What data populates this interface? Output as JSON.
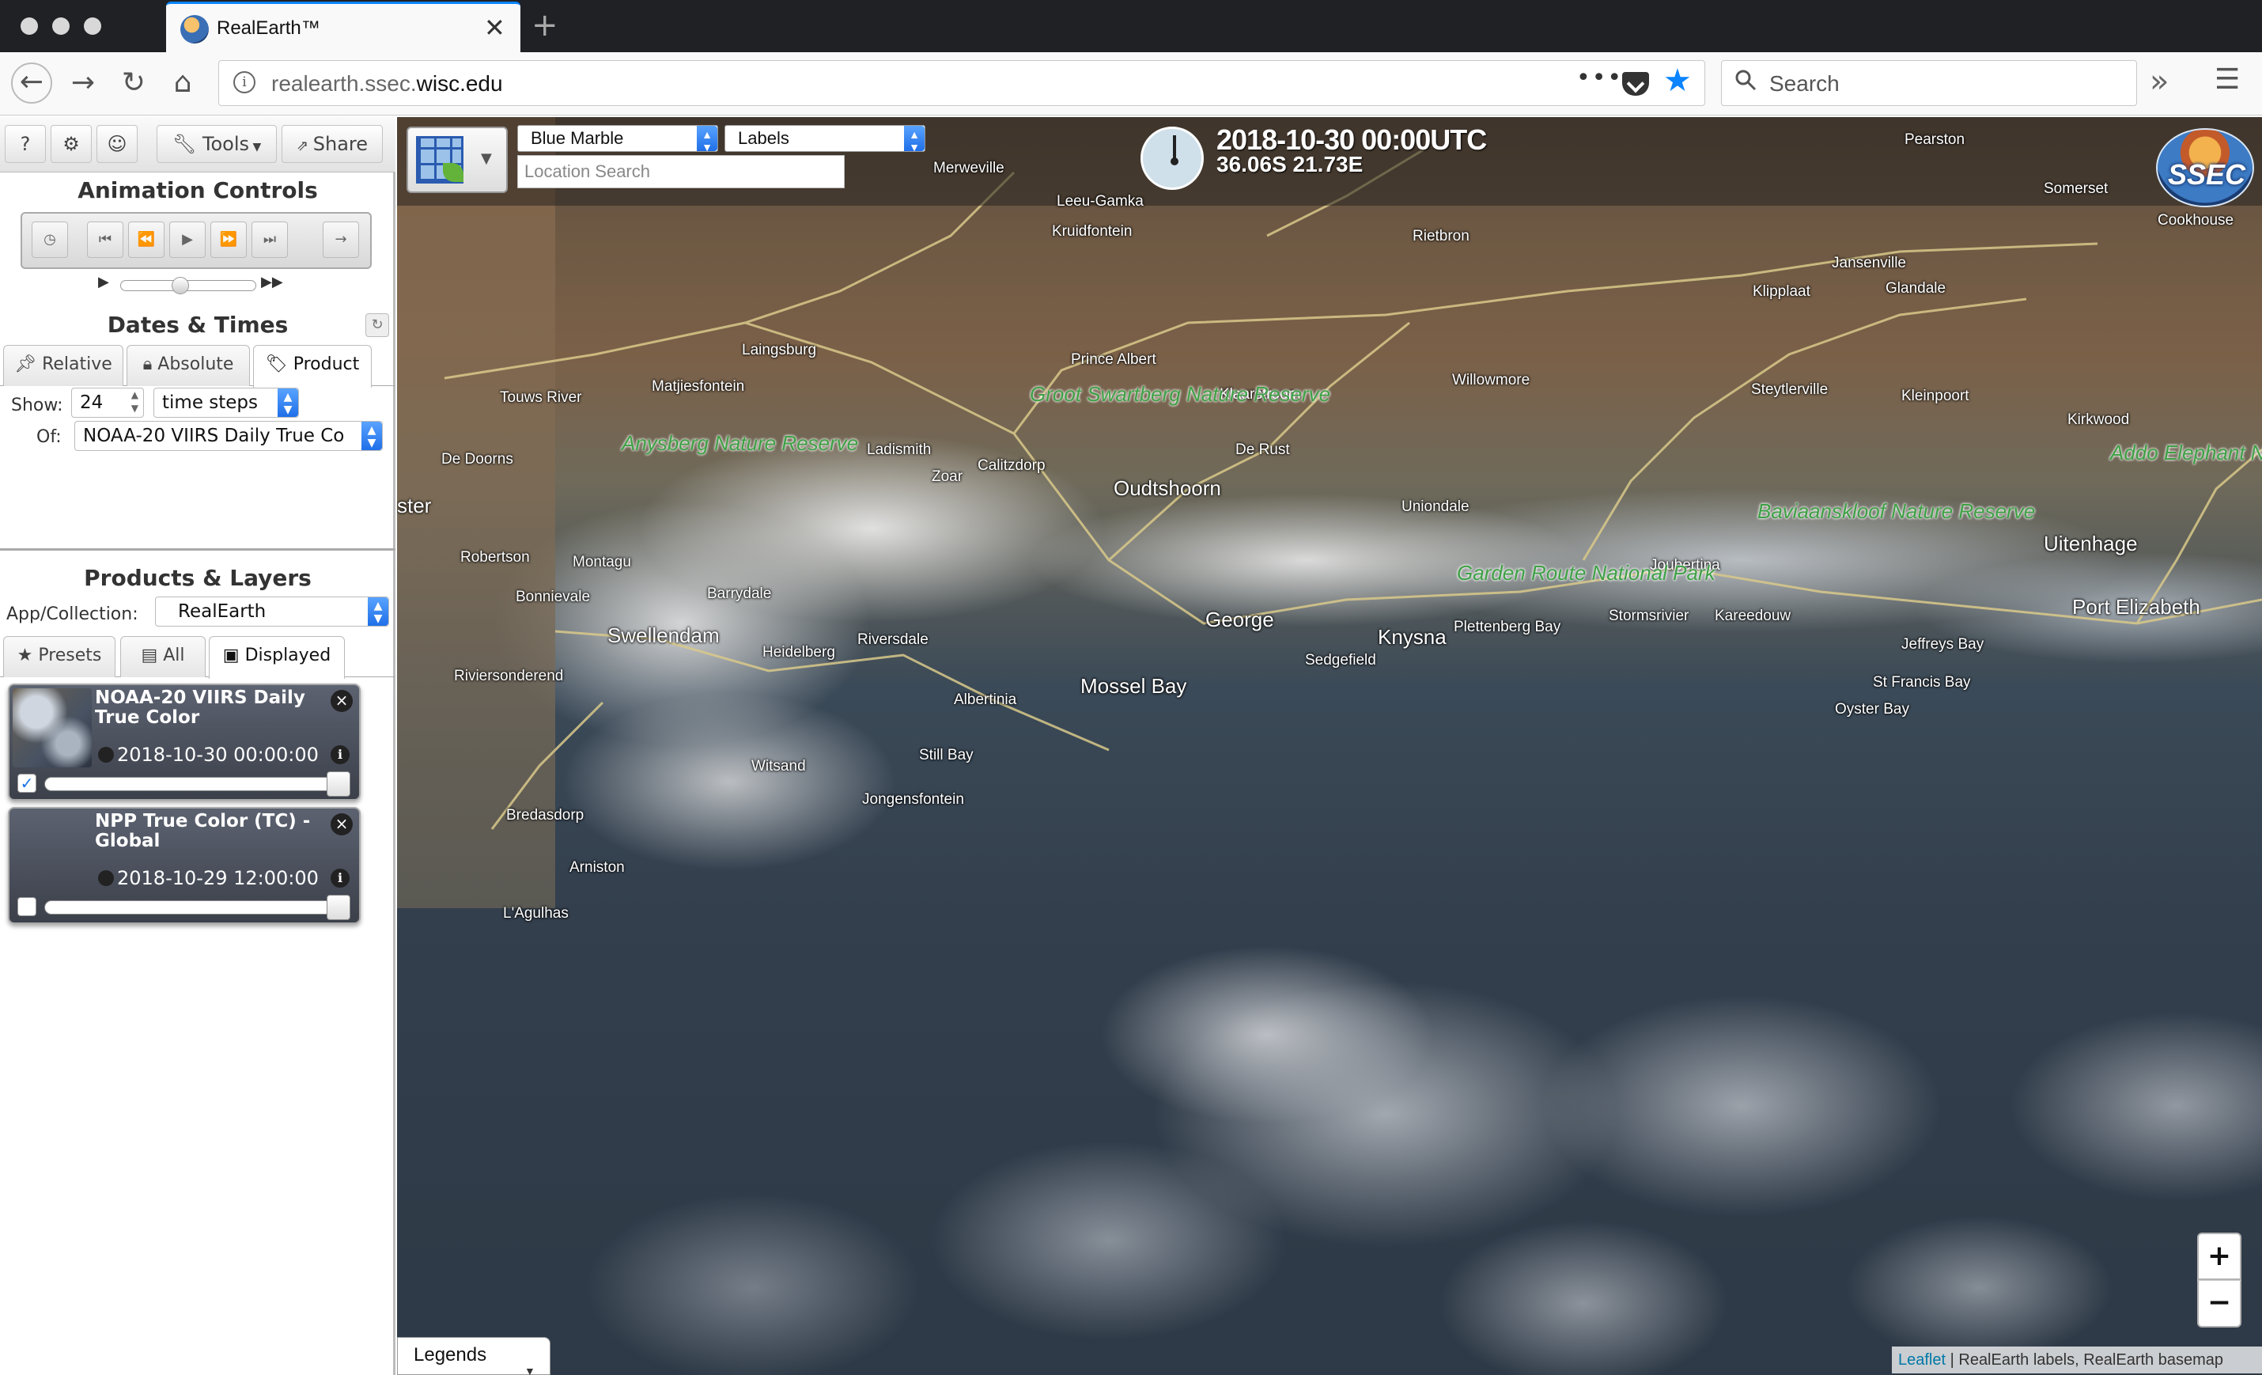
{
  "browser": {
    "tab_title": "RealEarth™",
    "url_host_prefix": "realearth.ssec.",
    "url_host_domain": "wisc.edu",
    "search_placeholder": "Search",
    "tab_close": "✕",
    "new_tab": "+"
  },
  "toolbar": {
    "help": "?",
    "settings": "⚙",
    "user": "☺",
    "tools_label": "Tools",
    "share_label": "Share"
  },
  "animation": {
    "title": "Animation Controls",
    "buttons": [
      "◷",
      "⏮",
      "⏪",
      "▶",
      "⏩",
      "⏭",
      "→"
    ]
  },
  "dates": {
    "title": "Dates & Times",
    "tabs": [
      {
        "label": "Relative",
        "icon": "pin-icon"
      },
      {
        "label": "Absolute",
        "icon": "lock-icon"
      },
      {
        "label": "Product",
        "icon": "tag-icon",
        "active": true
      }
    ],
    "show_label": "Show:",
    "show_value": "24",
    "unit_value": "time steps",
    "of_label": "Of:",
    "of_value": "NOAA-20 VIIRS Daily True Co"
  },
  "products": {
    "title": "Products & Layers",
    "collection_label": "App/Collection:",
    "collection_value": "RealEarth",
    "tabs": [
      {
        "label": "Presets",
        "icon": "star-icon"
      },
      {
        "label": "All",
        "icon": "folder-icon"
      },
      {
        "label": "Displayed",
        "icon": "image-icon",
        "active": true
      }
    ],
    "layers": [
      {
        "title": "NOAA-20 VIIRS Daily True Color",
        "time": "2018-10-30 00:00:00",
        "checked": true
      },
      {
        "title": "NPP True Color (TC) - Global",
        "time": "2018-10-29 12:00:00",
        "checked": false
      }
    ]
  },
  "map": {
    "basemap_value": "Blue Marble",
    "labels_value": "Labels",
    "location_placeholder": "Location Search",
    "datetime": "2018-10-30 00:00UTC",
    "coords": "36.06S 21.73E",
    "logo_text": "SSEC",
    "zoom_in": "+",
    "zoom_out": "−",
    "legends_label": "Legends",
    "attribution_link": "Leaflet",
    "attribution_text": " | RealEarth labels, RealEarth basemap",
    "places": [
      "Merweville",
      "Leeu-Gamka",
      "Kruidfontein",
      "Rietbron",
      "Pearston",
      "Somerset",
      "Cookhouse",
      "Jansenville",
      "Klipplaat",
      "Glandale",
      "Laingsburg",
      "Prince Albert",
      "Klaarstroom",
      "Willowmore",
      "Steytlerville",
      "Kleinpoort",
      "Kirkwood",
      "Touws River",
      "Matjiesfontein",
      "Ladismith",
      "Zoar",
      "Calitzdorp",
      "De Rust",
      "De Doorns",
      "Oudtshoorn",
      "Uniondale",
      "Uitenhage",
      "Robertson",
      "Montagu",
      "Bonnievale",
      "Barrydale",
      "Joubertina",
      "Port Elizabeth",
      "Swellendam",
      "Heidelberg",
      "Riversdale",
      "George",
      "Knysna",
      "Plettenberg Bay",
      "Stormsrivier",
      "Kareedouw",
      "Jeffreys Bay",
      "Sedgefield",
      "Riviersonderend",
      "Mossel Bay",
      "Albertinia",
      "St Francis Bay",
      "Oyster Bay",
      "Still Bay",
      "Witsand",
      "Jongensfontein",
      "Bredasdorp",
      "Arniston",
      "L'Agulhas",
      "ster"
    ],
    "reserves": [
      "Groot Swartberg Nature Reserve",
      "Anysberg Nature Reserve",
      "Garden Route National Park",
      "Baviaanskloof Nature Reserve",
      "Addo Elephant National Park"
    ]
  }
}
